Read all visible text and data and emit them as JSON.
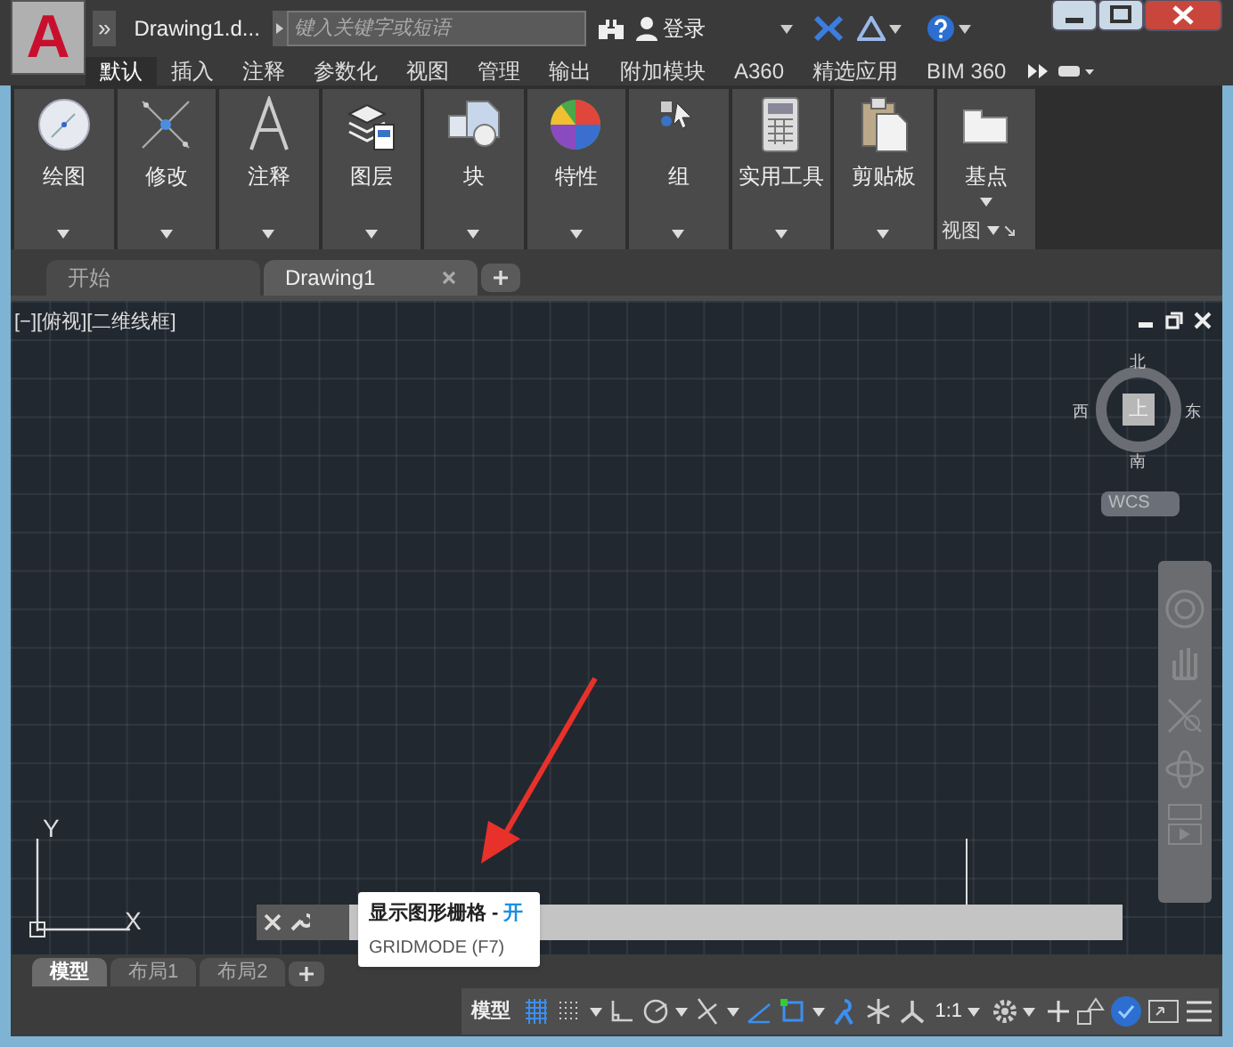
{
  "title_bar": {
    "app_letter": "A",
    "expand": "»",
    "title": "Drawing1.d...",
    "search": {
      "placeholder": "键入关键字或短语"
    },
    "sign_in": "登录"
  },
  "ribbon_tabs": [
    {
      "label": "默认",
      "selected": true
    },
    {
      "label": "插入",
      "selected": false
    },
    {
      "label": "注释",
      "selected": false
    },
    {
      "label": "参数化",
      "selected": false
    },
    {
      "label": "视图",
      "selected": false
    },
    {
      "label": "管理",
      "selected": false
    },
    {
      "label": "输出",
      "selected": false
    },
    {
      "label": "附加模块",
      "selected": false
    },
    {
      "label": "A360",
      "selected": false
    },
    {
      "label": "精选应用",
      "selected": false
    },
    {
      "label": "BIM 360",
      "selected": false
    }
  ],
  "ribbon_panels": [
    {
      "label": "绘图",
      "kind": "draw"
    },
    {
      "label": "修改",
      "kind": "modify"
    },
    {
      "label": "注释",
      "kind": "annotate"
    },
    {
      "label": "图层",
      "kind": "layers"
    },
    {
      "label": "块",
      "kind": "block"
    },
    {
      "label": "特性",
      "kind": "properties"
    },
    {
      "label": "组",
      "kind": "group"
    },
    {
      "label": "实用工具",
      "kind": "utilities"
    },
    {
      "label": "剪贴板",
      "kind": "clipboard"
    },
    {
      "label": "基点",
      "kind": "base",
      "footer": "视图"
    }
  ],
  "file_tabs": [
    {
      "label": "开始",
      "selected": false
    },
    {
      "label": "Drawing1",
      "selected": true
    }
  ],
  "viewport": {
    "label": "[−][俯视][二维线框]",
    "viewcube": {
      "north": "北",
      "south": "南",
      "east": "东",
      "west": "西",
      "face": "上",
      "ucs": "WCS"
    },
    "ucs_axes": {
      "y": "Y",
      "x": "X"
    }
  },
  "tooltip": {
    "title": "显示图形栅格 -",
    "state": "开",
    "command": "GRIDMODE (F7)"
  },
  "layout_tabs": [
    {
      "label": "模型",
      "selected": true
    },
    {
      "label": "布局1",
      "selected": false
    },
    {
      "label": "布局2",
      "selected": false
    }
  ],
  "status_bar": {
    "model": "模型",
    "scale": "1:1",
    "toggles": [
      {
        "kind": "grid",
        "on": true
      },
      {
        "kind": "snap",
        "on": false
      },
      {
        "kind": "ortho",
        "on": false
      },
      {
        "kind": "polar",
        "on": false
      },
      {
        "kind": "isodraft",
        "on": false
      },
      {
        "kind": "tracking",
        "on": true
      },
      {
        "kind": "osnap",
        "on": true
      },
      {
        "kind": "annovis",
        "on": true
      },
      {
        "kind": "autoscale",
        "on": false
      },
      {
        "kind": "annoscale",
        "on": false
      }
    ]
  }
}
